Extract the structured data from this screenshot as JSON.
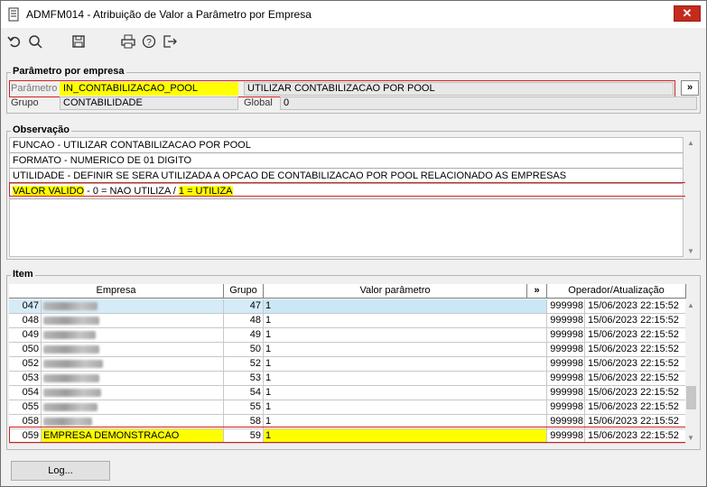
{
  "window": {
    "title": "ADMFM014 - Atribuição de Valor a Parâmetro por Empresa",
    "close_label": "✕"
  },
  "toolbar": {
    "icons": [
      "undo-icon",
      "search-icon",
      "save-icon",
      "print-icon",
      "help-icon",
      "exit-icon"
    ]
  },
  "param_section": {
    "legend": "Parâmetro por empresa",
    "parametro_label": "Parâmetro",
    "parametro_value": "IN_CONTABILIZACAO_POOL",
    "parametro_desc": "UTILIZAR CONTABILIZACAO POR POOL",
    "more_button": "»",
    "grupo_label": "Grupo",
    "grupo_value": "CONTABILIDADE",
    "global_label": "Global",
    "global_value": "0"
  },
  "obs_section": {
    "legend": "Observação",
    "lines": [
      "FUNCAO - UTILIZAR CONTABILIZACAO POR POOL",
      "FORMATO - NUMERICO DE 01 DIGITO",
      "UTILIDADE - DEFINIR SE SERA UTILIZADA A OPCAO DE CONTABILIZACAO POR POOL RELACIONADO AS EMPRESAS"
    ],
    "valid_line": {
      "part1": "VALOR VALIDO",
      "part2": " - 0 = NAO UTILIZA / ",
      "part3": "1 = UTILIZA"
    }
  },
  "item_section": {
    "legend": "Item",
    "headers": {
      "empresa": "Empresa",
      "grupo": "Grupo",
      "valor": "Valor parâmetro",
      "more": "»",
      "operador": "Operador/Atualização"
    },
    "rows": [
      {
        "code": "047",
        "empresa": "",
        "grupo": "47",
        "valor": "1",
        "operador": "999998",
        "data": "15/06/2023 22:15:52"
      },
      {
        "code": "048",
        "empresa": "",
        "grupo": "48",
        "valor": "1",
        "operador": "999998",
        "data": "15/06/2023 22:15:52"
      },
      {
        "code": "049",
        "empresa": "",
        "grupo": "49",
        "valor": "1",
        "operador": "999998",
        "data": "15/06/2023 22:15:52"
      },
      {
        "code": "050",
        "empresa": "",
        "grupo": "50",
        "valor": "1",
        "operador": "999998",
        "data": "15/06/2023 22:15:52"
      },
      {
        "code": "052",
        "empresa": "",
        "grupo": "52",
        "valor": "1",
        "operador": "999998",
        "data": "15/06/2023 22:15:52"
      },
      {
        "code": "053",
        "empresa": "",
        "grupo": "53",
        "valor": "1",
        "operador": "999998",
        "data": "15/06/2023 22:15:52"
      },
      {
        "code": "054",
        "empresa": "",
        "grupo": "54",
        "valor": "1",
        "operador": "999998",
        "data": "15/06/2023 22:15:52"
      },
      {
        "code": "055",
        "empresa": "",
        "grupo": "55",
        "valor": "1",
        "operador": "999998",
        "data": "15/06/2023 22:15:52"
      },
      {
        "code": "058",
        "empresa": "",
        "grupo": "58",
        "valor": "1",
        "operador": "999998",
        "data": "15/06/2023 22:15:52"
      },
      {
        "code": "059",
        "empresa": "EMPRESA DEMONSTRACAO",
        "grupo": "59",
        "valor": "1",
        "operador": "999998",
        "data": "15/06/2023 22:15:52"
      }
    ]
  },
  "footer": {
    "log_button": "Log..."
  },
  "colors": {
    "highlight": "#ffff00",
    "annotation_border": "#d42020",
    "selected_row": "#d5ebf8",
    "close_button": "#c42b1c"
  }
}
